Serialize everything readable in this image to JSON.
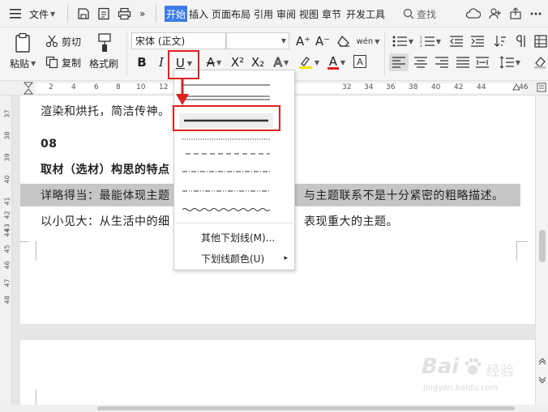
{
  "menubar": {
    "file_label": "文件",
    "more_label": "»",
    "tabs": [
      "开始",
      "插入",
      "页面布局",
      "引用",
      "审阅",
      "视图",
      "章节",
      "开发工具"
    ],
    "active_tab": "开始",
    "search_label": "查找"
  },
  "ribbon": {
    "paste_label": "粘贴",
    "cut_label": "剪切",
    "copy_label": "复制",
    "format_painter_label": "格式刷",
    "font_name": "宋体 (正文)",
    "font_size": "",
    "bold_label": "B",
    "italic_label": "I",
    "underline_label": "U",
    "strike_label": "A",
    "superscript_label": "X²",
    "subscript_label": "X₂",
    "font_effect_label": "A",
    "font_color_label": "A",
    "border_char_label": "A",
    "grow_font_label": "A⁺",
    "shrink_font_label": "A⁻",
    "phonetic_label": "wén",
    "colors": {
      "underline_box": "#e02020",
      "highlight": "#f5e400",
      "font_color": "#e02020"
    }
  },
  "ruler": {
    "numbers": [
      "2",
      "4",
      "6",
      "8",
      "10",
      "12",
      "32",
      "34",
      "36",
      "38",
      "40",
      "42",
      "44",
      "46"
    ],
    "vnumbers": [
      "37",
      "38",
      "39",
      "40",
      "41",
      "42",
      "43",
      "44",
      "45",
      "46",
      "47",
      "48"
    ]
  },
  "document": {
    "line1": "渲染和烘托，简洁传神。",
    "heading_num": "08",
    "heading": "取材（选材）构思的特点",
    "para1_a": "详略得当：最能体现主题",
    "para1_b": "与主题联系不是十分紧密的粗略描述。",
    "para2_a": "以小见大：从生活中的细",
    "para2_b": "表现重大的主题。"
  },
  "underline_menu": {
    "options": [
      "single",
      "double",
      "thick",
      "dotted",
      "dashed",
      "dash-dot",
      "dash-dot-dot",
      "wave"
    ],
    "more_label": "其他下划线(M)...",
    "color_label": "下划线颜色(U)",
    "submenu_arrow": "▸"
  },
  "watermark": {
    "brand": "Bai",
    "suffix": "经验",
    "url": "jingyan.baidu.com"
  }
}
